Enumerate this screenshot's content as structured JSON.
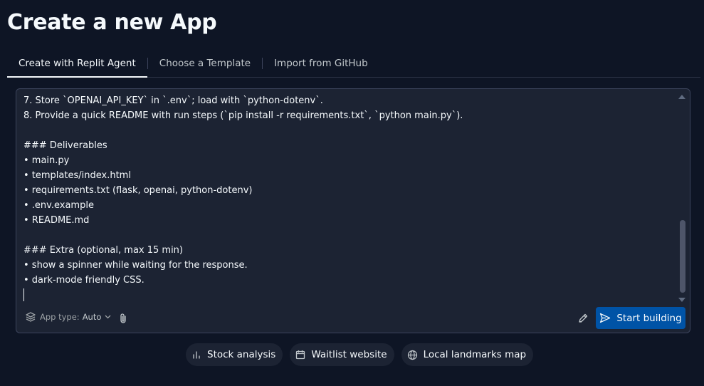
{
  "page": {
    "title": "Create a new App"
  },
  "tabs": [
    {
      "label": "Create with Replit Agent",
      "active": true
    },
    {
      "label": "Choose a Template",
      "active": false
    },
    {
      "label": "Import from GitHub",
      "active": false
    }
  ],
  "prompt": {
    "text": "7. Store `OPENAI_API_KEY` in `.env`; load with `python-dotenv`.\n8. Provide a quick README with run steps (`pip install -r requirements.txt`, `python main.py`).\n\n### Deliverables\n• main.py\n• templates/index.html\n• requirements.txt (flask, openai, python-dotenv)\n• .env.example\n• README.md\n\n### Extra (optional, max 15 min)\n• show a spinner while waiting for the response.\n• dark-mode friendly CSS."
  },
  "toolbar": {
    "app_type_label": "App type:",
    "app_type_value": "Auto",
    "start_label": "Start building"
  },
  "suggestions": [
    {
      "label": "Stock analysis",
      "icon": "bar-chart-icon"
    },
    {
      "label": "Waitlist website",
      "icon": "calendar-icon"
    },
    {
      "label": "Local landmarks map",
      "icon": "globe-icon"
    }
  ],
  "colors": {
    "background": "#0e1525",
    "panel": "#1c2333",
    "accent": "#0053a6"
  }
}
